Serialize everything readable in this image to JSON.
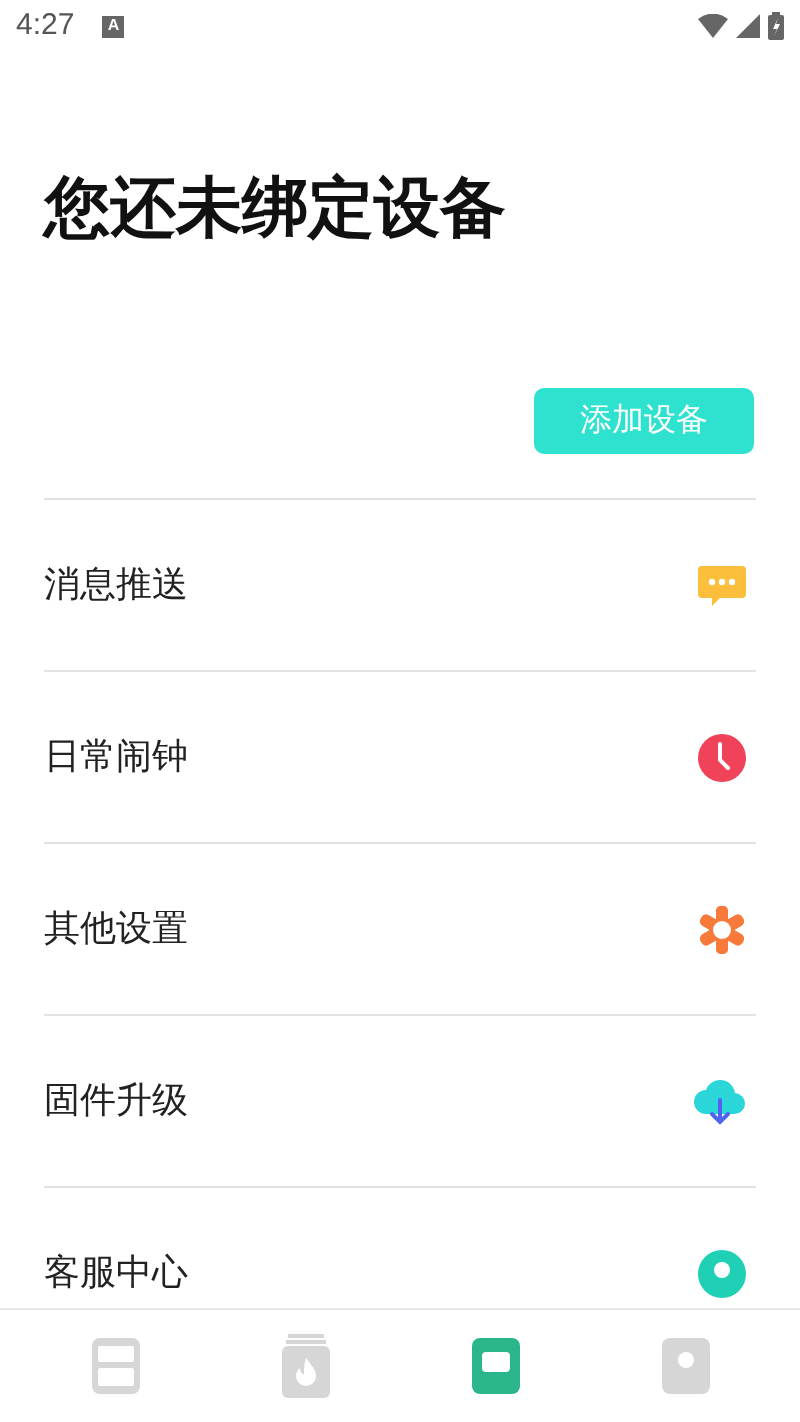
{
  "status_bar": {
    "time": "4:27",
    "notification": "A"
  },
  "title": "您还未绑定设备",
  "add_button": "添加设备",
  "menu": [
    {
      "label": "消息推送",
      "kind": "message"
    },
    {
      "label": "日常闹钟",
      "kind": "alarm"
    },
    {
      "label": "其他设置",
      "kind": "settings"
    },
    {
      "label": "固件升级",
      "kind": "upgrade"
    },
    {
      "label": "客服中心",
      "kind": "service"
    }
  ],
  "bottom_nav": [
    {
      "kind": "device",
      "selected": false
    },
    {
      "kind": "fire",
      "selected": false
    },
    {
      "kind": "home",
      "selected": true
    },
    {
      "kind": "profile",
      "selected": false
    }
  ]
}
